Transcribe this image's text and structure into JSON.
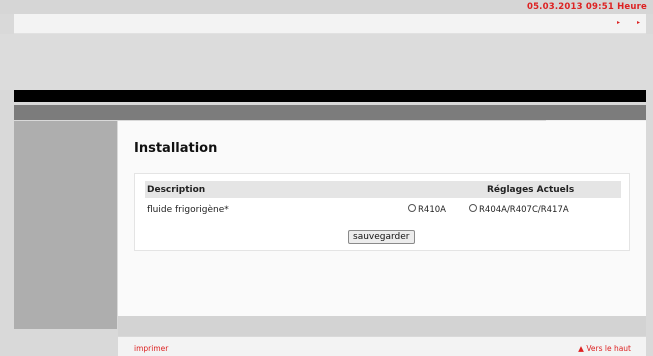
{
  "header": {
    "datetime": "05.03.2013  09:51 Heure",
    "nav_arrows": [
      "▸",
      "▸"
    ]
  },
  "page": {
    "title": "Installation"
  },
  "table": {
    "col_description": "Description",
    "col_settings": "Réglages Actuels",
    "row_label": "fluide frigorigène*",
    "options": [
      {
        "label": "R410A",
        "checked": false
      },
      {
        "label": "R404A/R407C/R417A",
        "checked": false
      }
    ]
  },
  "actions": {
    "save_label": "sauvegarder"
  },
  "footer": {
    "print_label": "imprimer",
    "top_label": "▲ Vers le haut"
  },
  "colors": {
    "accent_red": "#dd2222",
    "black_bar": "#000000",
    "gray_bar": "#7c7c7c",
    "sidebar": "#aeaeae"
  }
}
